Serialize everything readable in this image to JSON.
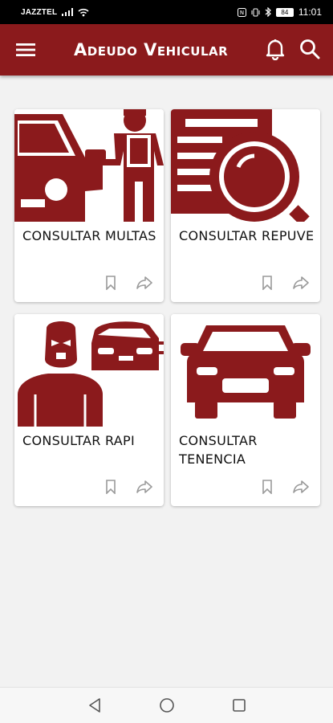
{
  "status_bar": {
    "carrier": "JAZZTEL",
    "battery": "84",
    "time": "11:01"
  },
  "app_bar": {
    "title": "Adeudo Vehicular",
    "icons": [
      "menu-icon",
      "bell-icon",
      "search-icon"
    ]
  },
  "colors": {
    "primary": "#8b1a1c",
    "background": "#f2f2f2"
  },
  "cards": [
    {
      "title": "CONSULTAR MULTAS",
      "image": "car-police-icon"
    },
    {
      "title": "CONSULTAR REPUVE",
      "image": "document-magnifier-icon"
    },
    {
      "title": "CONSULTAR RAPI",
      "image": "thief-car-icon"
    },
    {
      "title": "CONSULTAR TENENCIA",
      "image": "car-front-icon"
    }
  ],
  "card_actions": [
    "bookmark-icon",
    "share-icon"
  ],
  "nav_bar": [
    "back-icon",
    "home-icon",
    "recents-icon"
  ]
}
